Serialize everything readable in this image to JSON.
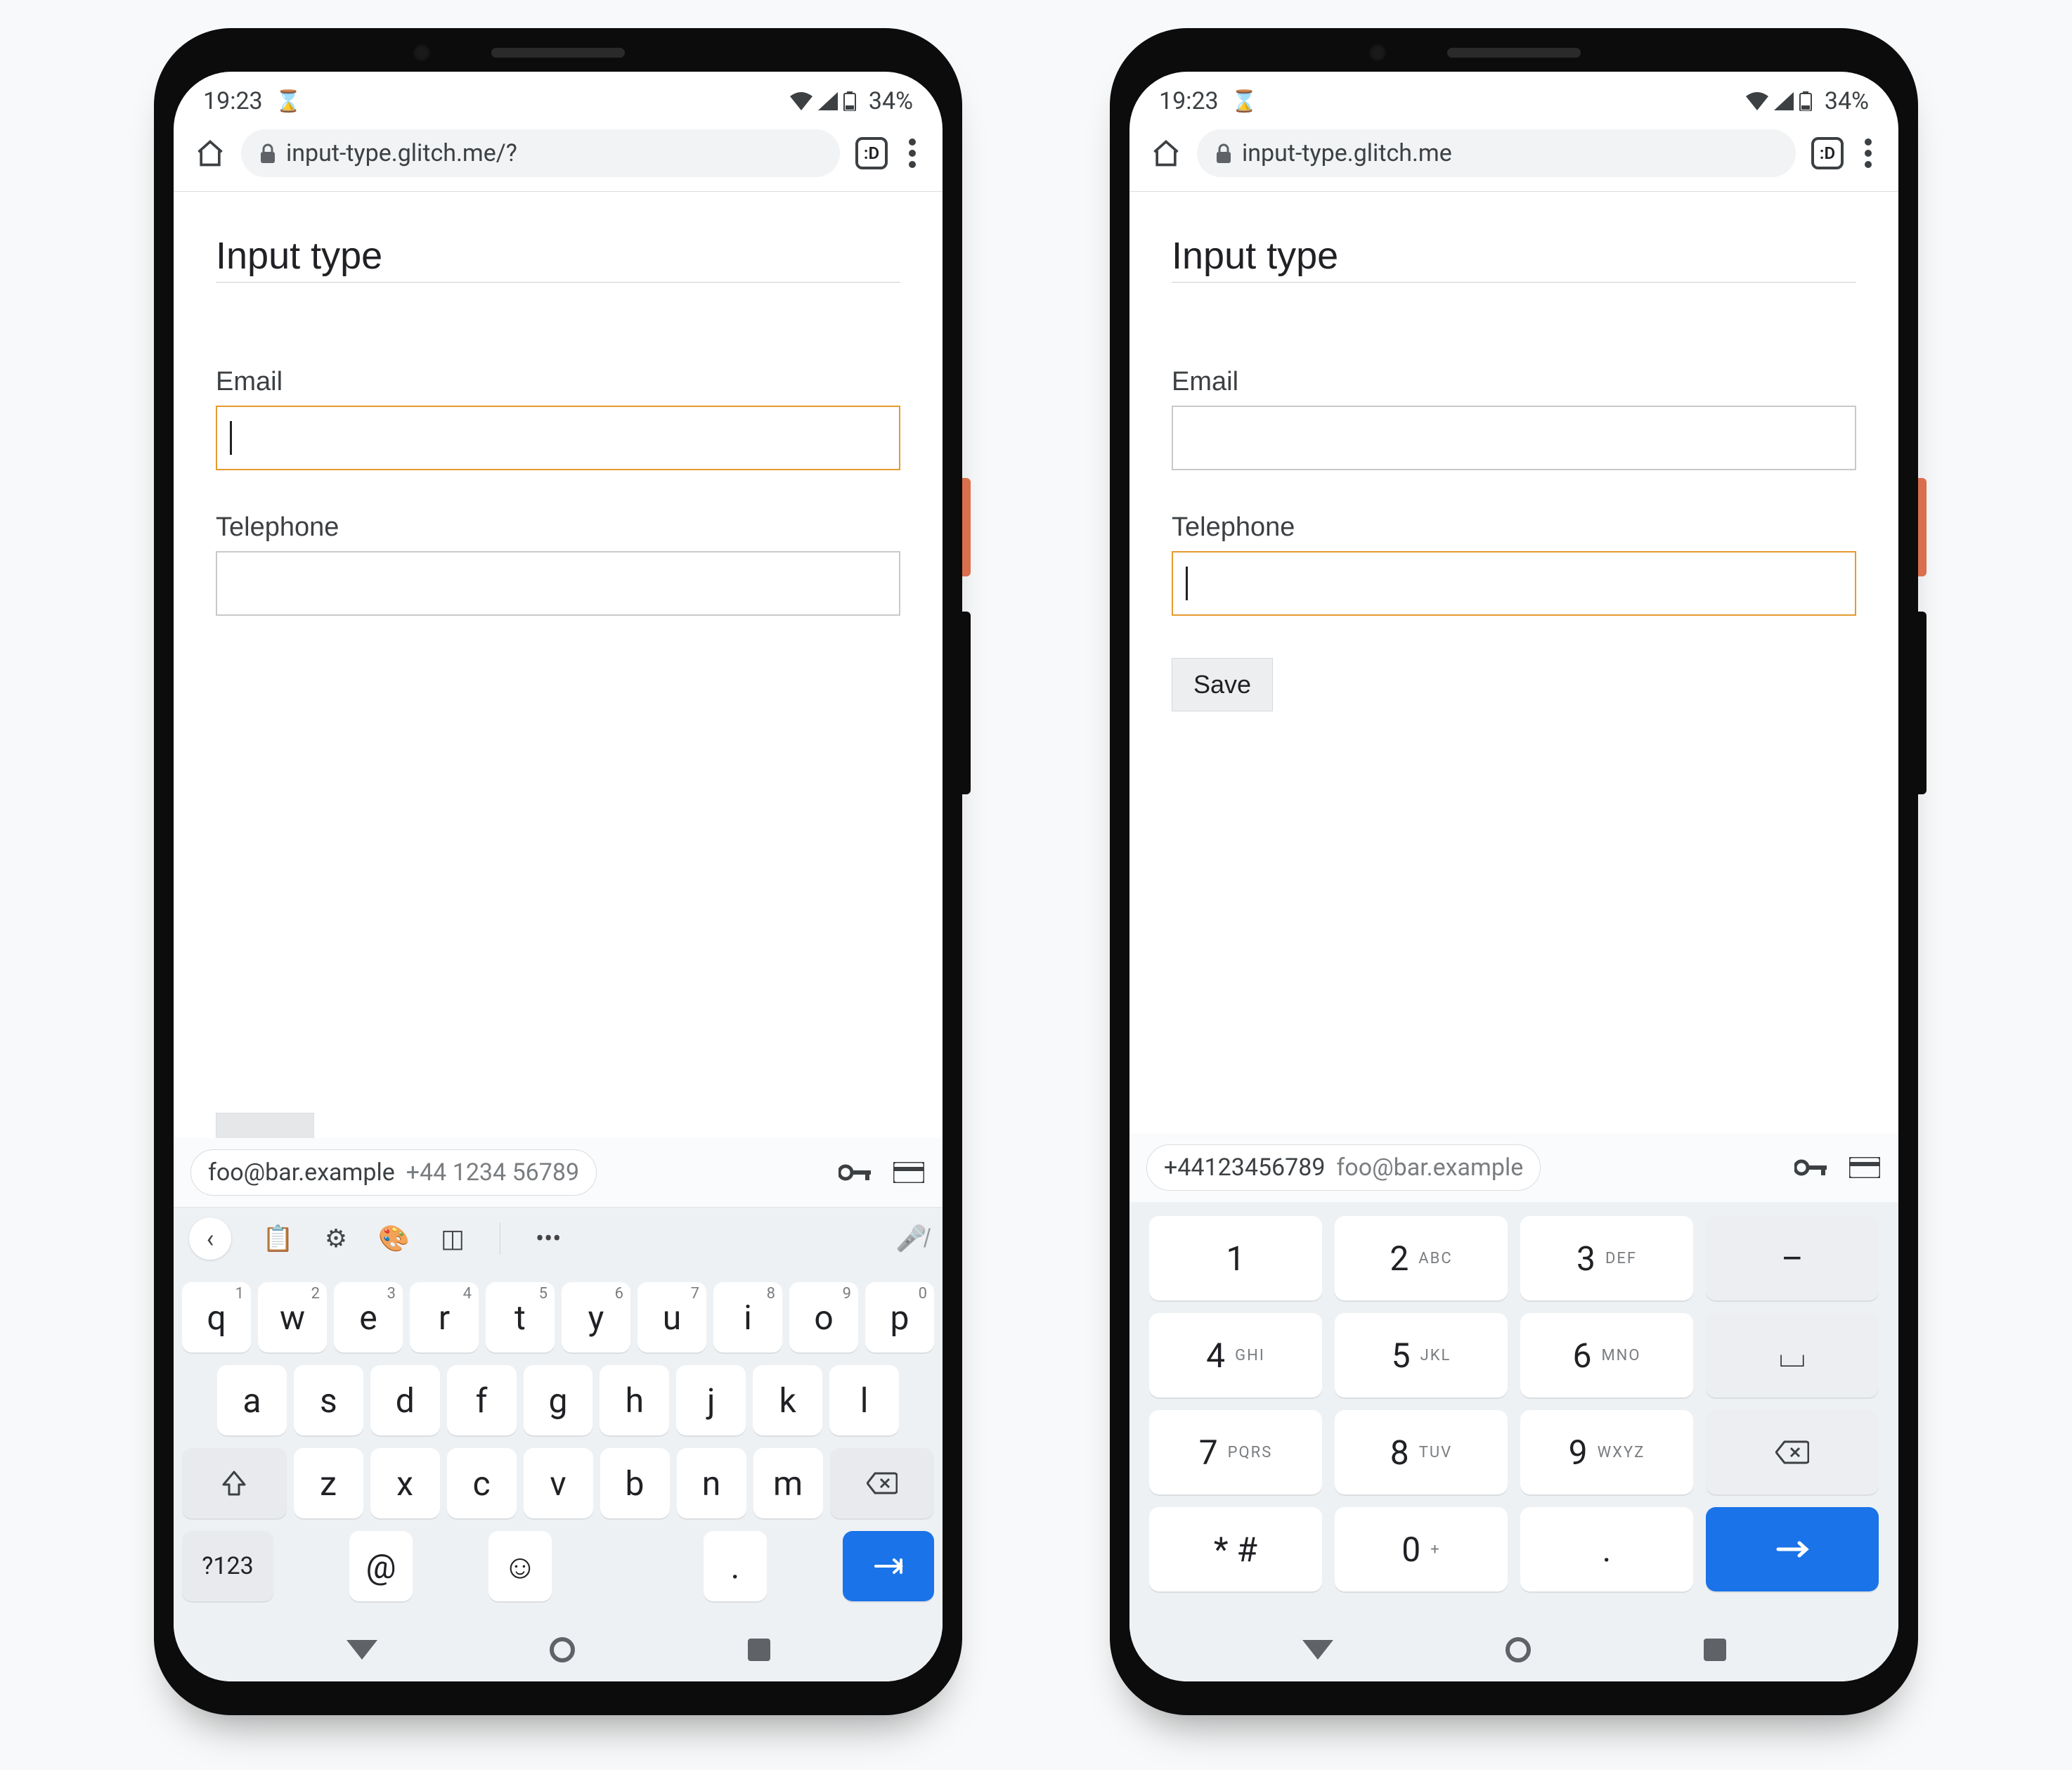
{
  "status": {
    "time": "19:23",
    "battery": "34%"
  },
  "browser": {
    "tab_indicator": ":D",
    "url_left": "input-type.glitch.me/?",
    "url_right": "input-type.glitch.me"
  },
  "page": {
    "title": "Input type",
    "email_label": "Email",
    "tel_label": "Telephone",
    "save_label": "Save"
  },
  "autofill": {
    "email": "foo@bar.example",
    "phone_spaced": "+44 1234 56789",
    "phone": "+44123456789"
  },
  "qwerty": {
    "r1": [
      {
        "k": "q",
        "s": "1"
      },
      {
        "k": "w",
        "s": "2"
      },
      {
        "k": "e",
        "s": "3"
      },
      {
        "k": "r",
        "s": "4"
      },
      {
        "k": "t",
        "s": "5"
      },
      {
        "k": "y",
        "s": "6"
      },
      {
        "k": "u",
        "s": "7"
      },
      {
        "k": "i",
        "s": "8"
      },
      {
        "k": "o",
        "s": "9"
      },
      {
        "k": "p",
        "s": "0"
      }
    ],
    "r2": [
      "a",
      "s",
      "d",
      "f",
      "g",
      "h",
      "j",
      "k",
      "l"
    ],
    "r3": [
      "z",
      "x",
      "c",
      "v",
      "b",
      "n",
      "m"
    ],
    "sym": "?123",
    "at": "@",
    "dot": "."
  },
  "numpad": {
    "r1": [
      {
        "k": "1",
        "s": ""
      },
      {
        "k": "2",
        "s": "ABC"
      },
      {
        "k": "3",
        "s": "DEF"
      },
      {
        "k": "–",
        "s": ""
      }
    ],
    "r2": [
      {
        "k": "4",
        "s": "GHI"
      },
      {
        "k": "5",
        "s": "JKL"
      },
      {
        "k": "6",
        "s": "MNO"
      },
      {
        "k": "⌴",
        "s": ""
      }
    ],
    "r3": [
      {
        "k": "7",
        "s": "PQRS"
      },
      {
        "k": "8",
        "s": "TUV"
      },
      {
        "k": "9",
        "s": "WXYZ"
      }
    ],
    "r4": [
      {
        "k": "* #",
        "s": ""
      },
      {
        "k": "0",
        "s": "+"
      },
      {
        "k": ".",
        "s": ""
      }
    ]
  }
}
